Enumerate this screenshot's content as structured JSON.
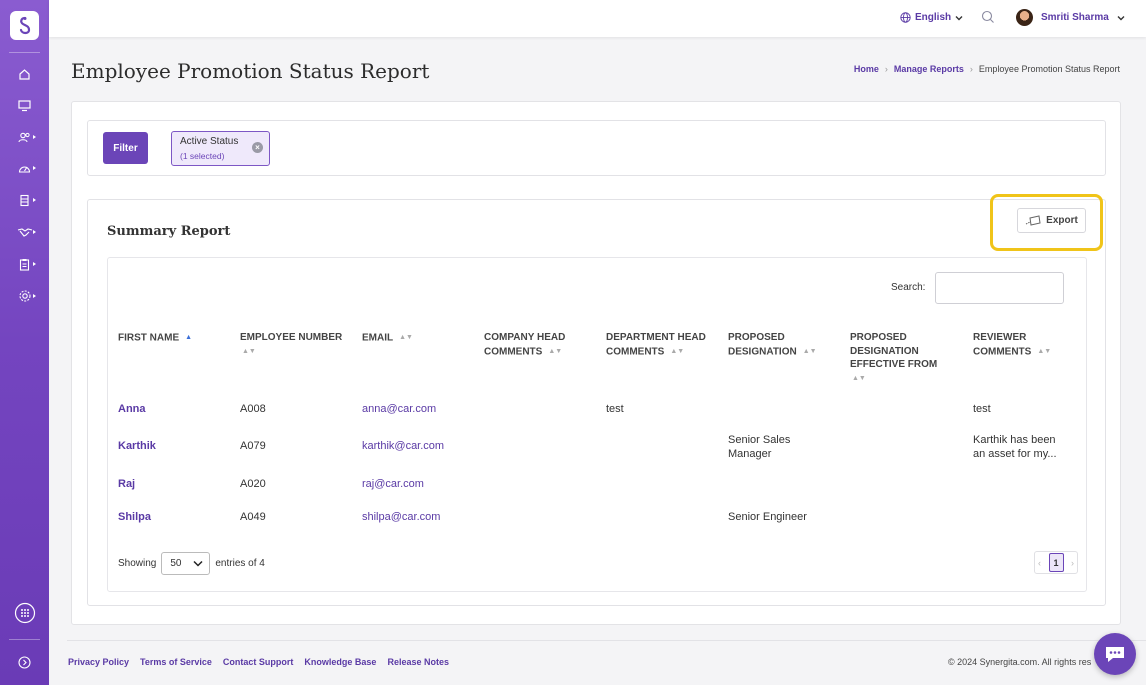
{
  "brand": {
    "accent": "#6b45b8",
    "highlight": "#f0c419"
  },
  "topbar": {
    "language": "English",
    "user_name": "Smriti Sharma"
  },
  "sidebar": {
    "items": [
      "home-icon",
      "monitor-icon",
      "users-icon",
      "dashboard-icon",
      "database-icon",
      "handshake-icon",
      "clipboard-icon",
      "settings-icon"
    ],
    "bottom": [
      "apps-grid-icon",
      "expand-icon"
    ]
  },
  "page": {
    "title": "Employee Promotion Status Report",
    "breadcrumb": [
      "Home",
      "Manage Reports",
      "Employee Promotion Status Report"
    ]
  },
  "filter": {
    "button_label": "Filter",
    "chip_title": "Active Status",
    "chip_sub": "(1 selected)"
  },
  "summary": {
    "title": "Summary Report",
    "export_label": "Export",
    "search_label": "Search:",
    "columns": [
      "FIRST NAME",
      "EMPLOYEE NUMBER",
      "EMAIL",
      "COMPANY HEAD COMMENTS",
      "DEPARTMENT HEAD COMMENTS",
      "PROPOSED DESIGNATION",
      "PROPOSED DESIGNATION EFFECTIVE FROM",
      "REVIEWER COMMENTS"
    ],
    "rows": [
      {
        "first_name": "Anna",
        "emp_no": "A008",
        "email": "anna@car.com",
        "company_head": "",
        "dept_head": "test",
        "designation": "",
        "effective": "",
        "reviewer": "test"
      },
      {
        "first_name": "Karthik",
        "emp_no": "A079",
        "email": "karthik@car.com",
        "company_head": "",
        "dept_head": "",
        "designation": "Senior Sales Manager",
        "effective": "",
        "reviewer": "Karthik has been an asset for my..."
      },
      {
        "first_name": "Raj",
        "emp_no": "A020",
        "email": "raj@car.com",
        "company_head": "",
        "dept_head": "",
        "designation": "",
        "effective": "",
        "reviewer": ""
      },
      {
        "first_name": "Shilpa",
        "emp_no": "A049",
        "email": "shilpa@car.com",
        "company_head": "",
        "dept_head": "",
        "designation": "Senior Engineer",
        "effective": "",
        "reviewer": ""
      }
    ],
    "showing_label": "Showing",
    "page_size": "50",
    "entries_label": "entries of 4",
    "current_page": "1"
  },
  "footer": {
    "links": [
      "Privacy Policy",
      "Terms of Service",
      "Contact Support",
      "Knowledge Base",
      "Release Notes"
    ],
    "copyright": "© 2024 Synergita.com. All rights res"
  }
}
